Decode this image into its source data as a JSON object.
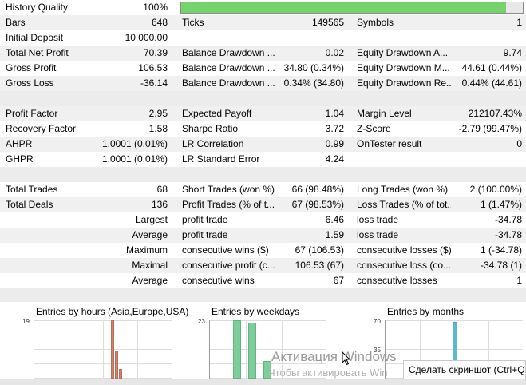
{
  "history_quality": {
    "label": "History Quality",
    "value": "100%",
    "fill_fraction": 0.95
  },
  "rows": [
    {
      "c1": [
        "Bars",
        "648"
      ],
      "c2": [
        "Ticks",
        "149565"
      ],
      "c3": [
        "Symbols",
        "1"
      ]
    },
    {
      "c1": [
        "Initial Deposit",
        "10 000.00"
      ],
      "c2": [
        "",
        ""
      ],
      "c3": [
        "",
        ""
      ]
    },
    {
      "c1": [
        "Total Net Profit",
        "70.39"
      ],
      "c2": [
        "Balance Drawdown ...",
        "0.02"
      ],
      "c3": [
        "Equity Drawdown A...",
        "9.74"
      ]
    },
    {
      "c1": [
        "Gross Profit",
        "106.53"
      ],
      "c2": [
        "Balance Drawdown ...",
        "34.80 (0.34%)"
      ],
      "c3": [
        "Equity Drawdown M...",
        "44.61 (0.44%)"
      ]
    },
    {
      "c1": [
        "Gross Loss",
        "-36.14"
      ],
      "c2": [
        "Balance Drawdown ...",
        "0.34% (34.80)"
      ],
      "c3": [
        "Equity Drawdown Re...",
        "0.44% (44.61)"
      ]
    },
    {
      "sep": true
    },
    {
      "c1": [
        "Profit Factor",
        "2.95"
      ],
      "c2": [
        "Expected Payoff",
        "1.04"
      ],
      "c3": [
        "Margin Level",
        "212107.43%"
      ]
    },
    {
      "c1": [
        "Recovery Factor",
        "1.58"
      ],
      "c2": [
        "Sharpe Ratio",
        "3.72"
      ],
      "c3": [
        "Z-Score",
        "-2.79 (99.47%)"
      ]
    },
    {
      "c1": [
        "AHPR",
        "1.0001 (0.01%)"
      ],
      "c2": [
        "LR Correlation",
        "0.99"
      ],
      "c3": [
        "OnTester result",
        "0"
      ]
    },
    {
      "c1": [
        "GHPR",
        "1.0001 (0.01%)"
      ],
      "c2": [
        "LR Standard Error",
        "4.24"
      ],
      "c3": [
        "",
        ""
      ]
    },
    {
      "sep": true
    },
    {
      "c1": [
        "Total Trades",
        "68"
      ],
      "c2": [
        "Short Trades (won %)",
        "66 (98.48%)"
      ],
      "c3": [
        "Long Trades (won %)",
        "2 (100.00%)"
      ]
    },
    {
      "c1": [
        "Total Deals",
        "136"
      ],
      "c2": [
        "Profit Trades (% of t...",
        "67 (98.53%)"
      ],
      "c3": [
        "Loss Trades (% of tot...",
        "1 (1.47%)"
      ]
    },
    {
      "c1r": "Largest",
      "c2": [
        "profit trade",
        "6.46"
      ],
      "c3": [
        "loss trade",
        "-34.78"
      ]
    },
    {
      "c1r": "Average",
      "c2": [
        "profit trade",
        "1.59"
      ],
      "c3": [
        "loss trade",
        "-34.78"
      ]
    },
    {
      "c1r": "Maximum",
      "c2": [
        "consecutive wins ($)",
        "67 (106.53)"
      ],
      "c3": [
        "consecutive losses ($)",
        "1 (-34.78)"
      ]
    },
    {
      "c1r": "Maximal",
      "c2": [
        "consecutive profit (c...",
        "106.53 (67)"
      ],
      "c3": [
        "consecutive loss (co...",
        "-34.78 (1)"
      ]
    },
    {
      "c1r": "Average",
      "c2": [
        "consecutive wins",
        "67"
      ],
      "c3": [
        "consecutive losses",
        "1"
      ]
    },
    {
      "sep": true
    }
  ],
  "charts": [
    {
      "title": "Entries by hours (Asia,Europe,USA)",
      "ymax_label": "19",
      "color": "#d4836a",
      "bars": [
        19,
        9,
        3
      ]
    },
    {
      "title": "Entries by weekdays",
      "ymax_label": "23",
      "color": "#7ccf9a",
      "bars": [
        23,
        22,
        7
      ]
    },
    {
      "title": "Entries by months",
      "ymax_label": "70",
      "color": "#5bb8d0",
      "ymax2_label": "35",
      "bars": [
        68
      ]
    }
  ],
  "watermark": {
    "line1": "Активация Windows",
    "line2": "Чтобы активировать Win"
  },
  "tooltip": "Сделать скриншот (Ctrl+Q)"
}
